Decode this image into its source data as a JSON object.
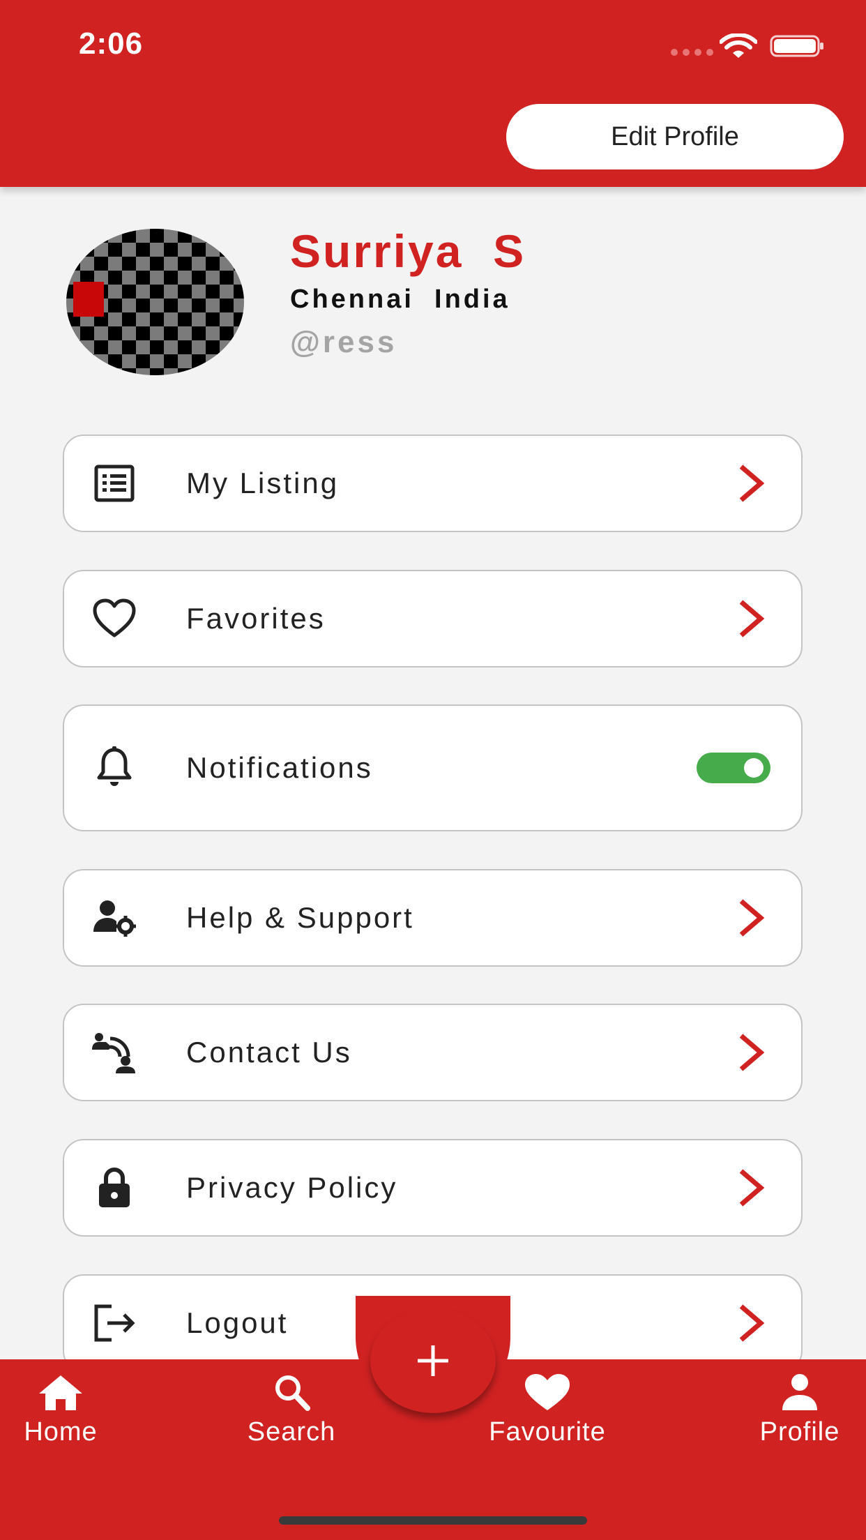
{
  "status_bar": {
    "time": "2:06"
  },
  "header": {
    "edit_button_label": "Edit Profile"
  },
  "profile": {
    "name": "Surriya  S",
    "location": "Chennai  India",
    "handle": "@ress"
  },
  "menu": {
    "items": [
      {
        "label": "My Listing",
        "icon": "list-icon"
      },
      {
        "label": "Favorites",
        "icon": "heart-outline-icon"
      },
      {
        "label": "Notifications",
        "icon": "bell-icon",
        "toggle_on": true
      },
      {
        "label": "Help & Support",
        "icon": "user-settings-icon"
      },
      {
        "label": "Contact Us",
        "icon": "contact-icon"
      },
      {
        "label": "Privacy Policy",
        "icon": "lock-icon"
      },
      {
        "label": "Logout",
        "icon": "logout-icon"
      }
    ]
  },
  "bottom_nav": {
    "items": [
      {
        "label": "Home",
        "icon": "home-icon"
      },
      {
        "label": "Search",
        "icon": "search-icon"
      },
      {
        "label": "Favourite",
        "icon": "heart-icon"
      },
      {
        "label": "Profile",
        "icon": "person-icon"
      }
    ],
    "fab_icon": "plus-icon"
  },
  "colors": {
    "brand_red": "#d12222",
    "toggle_green": "#45ab4b",
    "background": "#f3f3f3"
  }
}
